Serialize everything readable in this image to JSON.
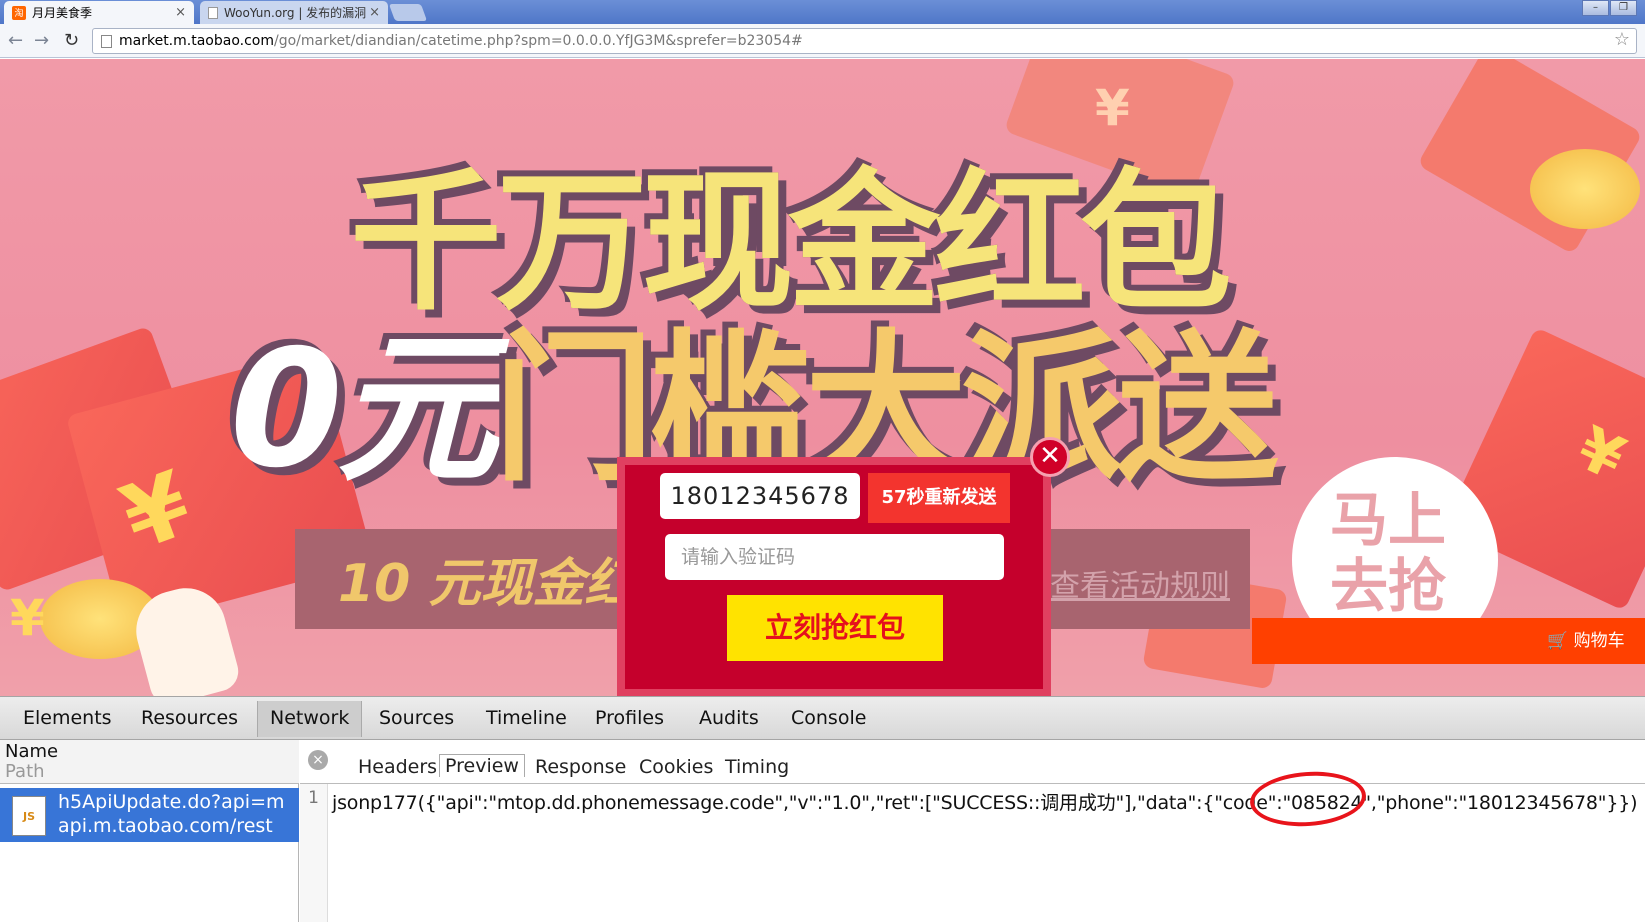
{
  "browser": {
    "tabs": [
      {
        "title": "月月美食季",
        "favicon": "淘",
        "active": true
      },
      {
        "title": "WooYun.org | 发布的漏洞",
        "favicon": "",
        "active": false
      }
    ],
    "tab_close": "×",
    "address": {
      "host": "market.m.taobao.com",
      "path": "/go/market/diandian/catetime.php?spm=0.0.0.0.YfJG3M&sprefer=b23054#"
    },
    "nav": {
      "back": "←",
      "forward": "→",
      "reload": "↻",
      "star": "☆"
    },
    "window_buttons": {
      "minimize": "–",
      "restore": "❐"
    }
  },
  "page": {
    "headline_line1": "千万现金红包",
    "headline_zero": "0元",
    "headline_rest": "门槛大派送",
    "banner_text": "10 元现金红",
    "rules_link": "查看活动规则",
    "grab_badge": "马上去抢",
    "cart_label": "购物车",
    "yen": "¥",
    "colors": {
      "modal_bg": "#c5002c",
      "resend_bg": "#f3342e",
      "grab_bg": "#ffe300",
      "cart_bg": "#ff4000"
    },
    "modal": {
      "close": "✕",
      "phone_value": "18012345678",
      "resend_label": "57秒重新发送",
      "code_placeholder": "请输入验证码",
      "grab_label": "立刻抢红包"
    }
  },
  "devtools": {
    "tabs": [
      "Elements",
      "Resources",
      "Network",
      "Sources",
      "Timeline",
      "Profiles",
      "Audits",
      "Console"
    ],
    "active_tab": "Network",
    "name_header": "Name",
    "path_header": "Path",
    "request": {
      "name": "h5ApiUpdate.do?api=m",
      "path": "api.m.taobao.com/rest",
      "icon": "JS"
    },
    "close_icon": "×",
    "subtabs": [
      "Headers",
      "Preview",
      "Response",
      "Cookies",
      "Timing"
    ],
    "active_subtab": "Preview",
    "line_number": "1",
    "response_line": "jsonp177({\"api\":\"mtop.dd.phonemessage.code\",\"v\":\"1.0\",\"ret\":[\"SUCCESS::调用成功\"],\"data\":{\"code\":\"085824\",\"phone\":\"18012345678\"}})"
  }
}
